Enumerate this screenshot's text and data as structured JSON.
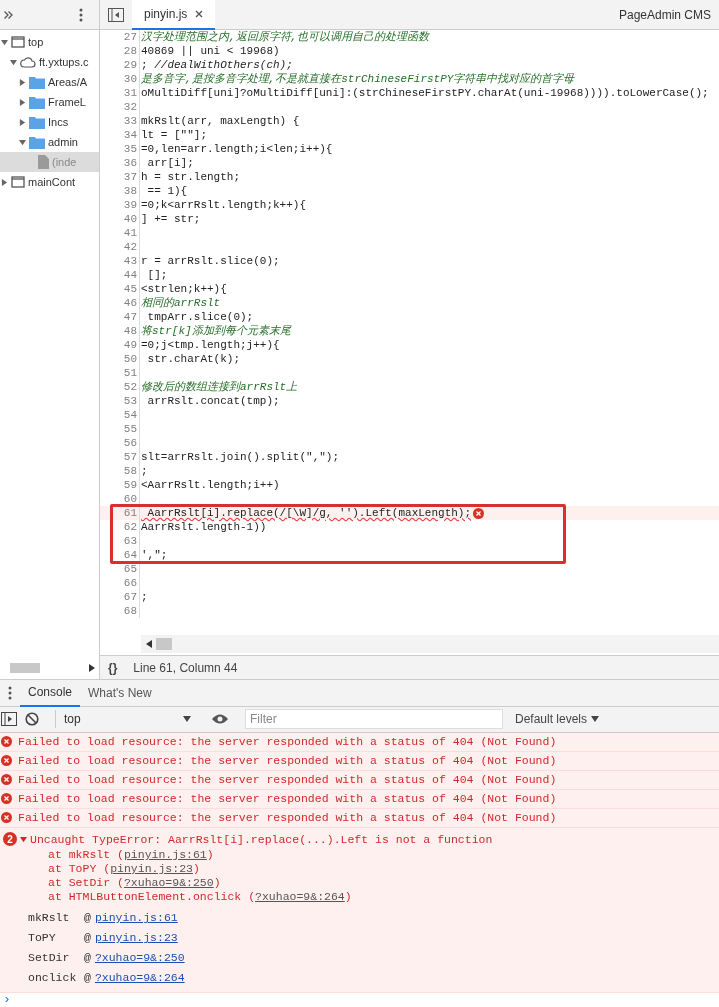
{
  "sidebar": {
    "tree": [
      {
        "label": "top",
        "kind": "frame",
        "expanded": true,
        "selected": false,
        "children": [
          {
            "label": "ft.yxtups.c",
            "kind": "domain",
            "expanded": true,
            "selected": false,
            "children": [
              {
                "label": "Areas/A",
                "kind": "folder",
                "expanded": false,
                "selected": false
              },
              {
                "label": "FrameL",
                "kind": "folder",
                "expanded": false,
                "selected": false
              },
              {
                "label": "Incs",
                "kind": "folder",
                "expanded": false,
                "selected": false
              },
              {
                "label": "admin",
                "kind": "folder",
                "expanded": true,
                "selected": false,
                "children": [
                  {
                    "label": "(inde",
                    "kind": "file",
                    "selected": true
                  }
                ]
              }
            ]
          }
        ]
      },
      {
        "label": "mainCont",
        "kind": "frame",
        "expanded": false,
        "selected": false
      }
    ]
  },
  "editor": {
    "tabs": [
      {
        "label": "pinyin.js",
        "selected": true
      }
    ],
    "title": "PageAdmin CMS",
    "lines": [
      {
        "number": "27",
        "kind": "comment",
        "text": "汉字处理范围之内,返回原字符,也可以调用自己的处理函数"
      },
      {
        "number": "28",
        "kind": "code",
        "text": "40869 || uni < 19968)"
      },
      {
        "number": "29",
        "kind": "code",
        "text": "; *//dealWithOthers(ch);*"
      },
      {
        "number": "30",
        "kind": "comment",
        "text": "是多音字,是按多音字处理,不是就直接在strChineseFirstPY字符串中找对应的首字母"
      },
      {
        "number": "31",
        "kind": "code",
        "text": "oMultiDiff[uni]?oMultiDiff[uni]:(strChineseFirstPY.charAt(uni-19968)))).toLowerCase();"
      },
      {
        "number": "32"
      },
      {
        "number": "33",
        "kind": "code",
        "text": "mkRslt(arr, maxLength) {"
      },
      {
        "number": "34",
        "kind": "code",
        "text": "lt = [\"\"];"
      },
      {
        "number": "35",
        "kind": "code",
        "text": "=0,len=arr.length;i<len;i++){"
      },
      {
        "number": "36",
        "kind": "code",
        "text": " arr[i];"
      },
      {
        "number": "37",
        "kind": "code",
        "text": "h = str.length;"
      },
      {
        "number": "38",
        "kind": "code",
        "text": " == 1){"
      },
      {
        "number": "39",
        "kind": "code",
        "text": "=0;k<arrRslt.length;k++){"
      },
      {
        "number": "40",
        "kind": "code",
        "text": "] += str;"
      },
      {
        "number": "41"
      },
      {
        "number": "42"
      },
      {
        "number": "43",
        "kind": "code",
        "text": "r = arrRslt.slice(0);"
      },
      {
        "number": "44",
        "kind": "code",
        "text": " [];"
      },
      {
        "number": "45",
        "kind": "code",
        "text": "<strlen;k++){"
      },
      {
        "number": "46",
        "kind": "comment",
        "text": "相同的arrRslt"
      },
      {
        "number": "47",
        "kind": "code",
        "text": " tmpArr.slice(0);"
      },
      {
        "number": "48",
        "kind": "comment",
        "text": "将str[k]添加到每个元素末尾"
      },
      {
        "number": "49",
        "kind": "code",
        "text": "=0;j<tmp.length;j++){"
      },
      {
        "number": "50",
        "kind": "code",
        "text": " str.charAt(k);"
      },
      {
        "number": "51"
      },
      {
        "number": "52",
        "kind": "comment",
        "text": "修改后的数组连接到arrRslt上"
      },
      {
        "number": "53",
        "kind": "code",
        "text": " arrRslt.concat(tmp);"
      },
      {
        "number": "54"
      },
      {
        "number": "55"
      },
      {
        "number": "56"
      },
      {
        "number": "57",
        "kind": "code",
        "text": "slt=arrRslt.join().split(\",\");"
      },
      {
        "number": "58",
        "kind": "code",
        "text": ";"
      },
      {
        "number": "59",
        "kind": "code",
        "text": "<AarrRslt.length;i++)"
      },
      {
        "number": "60"
      },
      {
        "number": "61",
        "kind": "code",
        "text": " AarrRslt[i].replace(/[\\W]/g, '').Left(maxLength);",
        "error": true
      },
      {
        "number": "62",
        "kind": "code",
        "text": "AarrRslt.length-1))"
      },
      {
        "number": "63"
      },
      {
        "number": "64",
        "kind": "code",
        "text": "',\";"
      },
      {
        "number": "65"
      },
      {
        "number": "66"
      },
      {
        "number": "67",
        "kind": "code",
        "text": ";"
      },
      {
        "number": "68"
      }
    ],
    "status": {
      "format_icon": "{}",
      "position": "Line 61, Column 44"
    }
  },
  "drawer": {
    "tabs": [
      {
        "label": "Console",
        "selected": true
      },
      {
        "label": "What's New",
        "selected": false
      }
    ],
    "toolbar": {
      "context": "top",
      "filter_placeholder": "Filter",
      "levels": "Default levels"
    },
    "messages": [
      {
        "kind": "error",
        "text": "Failed to load resource: the server responded with a status of 404 (Not Found)"
      },
      {
        "kind": "error",
        "text": "Failed to load resource: the server responded with a status of 404 (Not Found)"
      },
      {
        "kind": "error",
        "text": "Failed to load resource: the server responded with a status of 404 (Not Found)"
      },
      {
        "kind": "error",
        "text": "Failed to load resource: the server responded with a status of 404 (Not Found)"
      },
      {
        "kind": "error",
        "text": "Failed to load resource: the server responded with a status of 404 (Not Found)"
      }
    ],
    "exception": {
      "count": "2",
      "expanded": true,
      "text": "Uncaught TypeError: AarrRslt[i].replace(...).Left is not a function",
      "stack": [
        {
          "prefix": "at mkRslt (",
          "link": "pinyin.js:61",
          "suffix": ")"
        },
        {
          "prefix": "at ToPY (",
          "link": "pinyin.js:23",
          "suffix": ")"
        },
        {
          "prefix": "at SetDir (",
          "link": "?xuhao=9&:250",
          "suffix": ")"
        },
        {
          "prefix": "at HTMLButtonElement.onclick (",
          "link": "?xuhao=9&:264",
          "suffix": ")"
        }
      ],
      "call_stack": [
        {
          "function": "mkRslt",
          "at": "@",
          "link": "pinyin.js:61"
        },
        {
          "function": "ToPY",
          "at": "@",
          "link": "pinyin.js:23"
        },
        {
          "function": "SetDir",
          "at": "@",
          "link": "?xuhao=9&:250"
        },
        {
          "function": "onclick",
          "at": "@",
          "link": "?xuhao=9&:264"
        }
      ]
    },
    "prompt": "›"
  }
}
